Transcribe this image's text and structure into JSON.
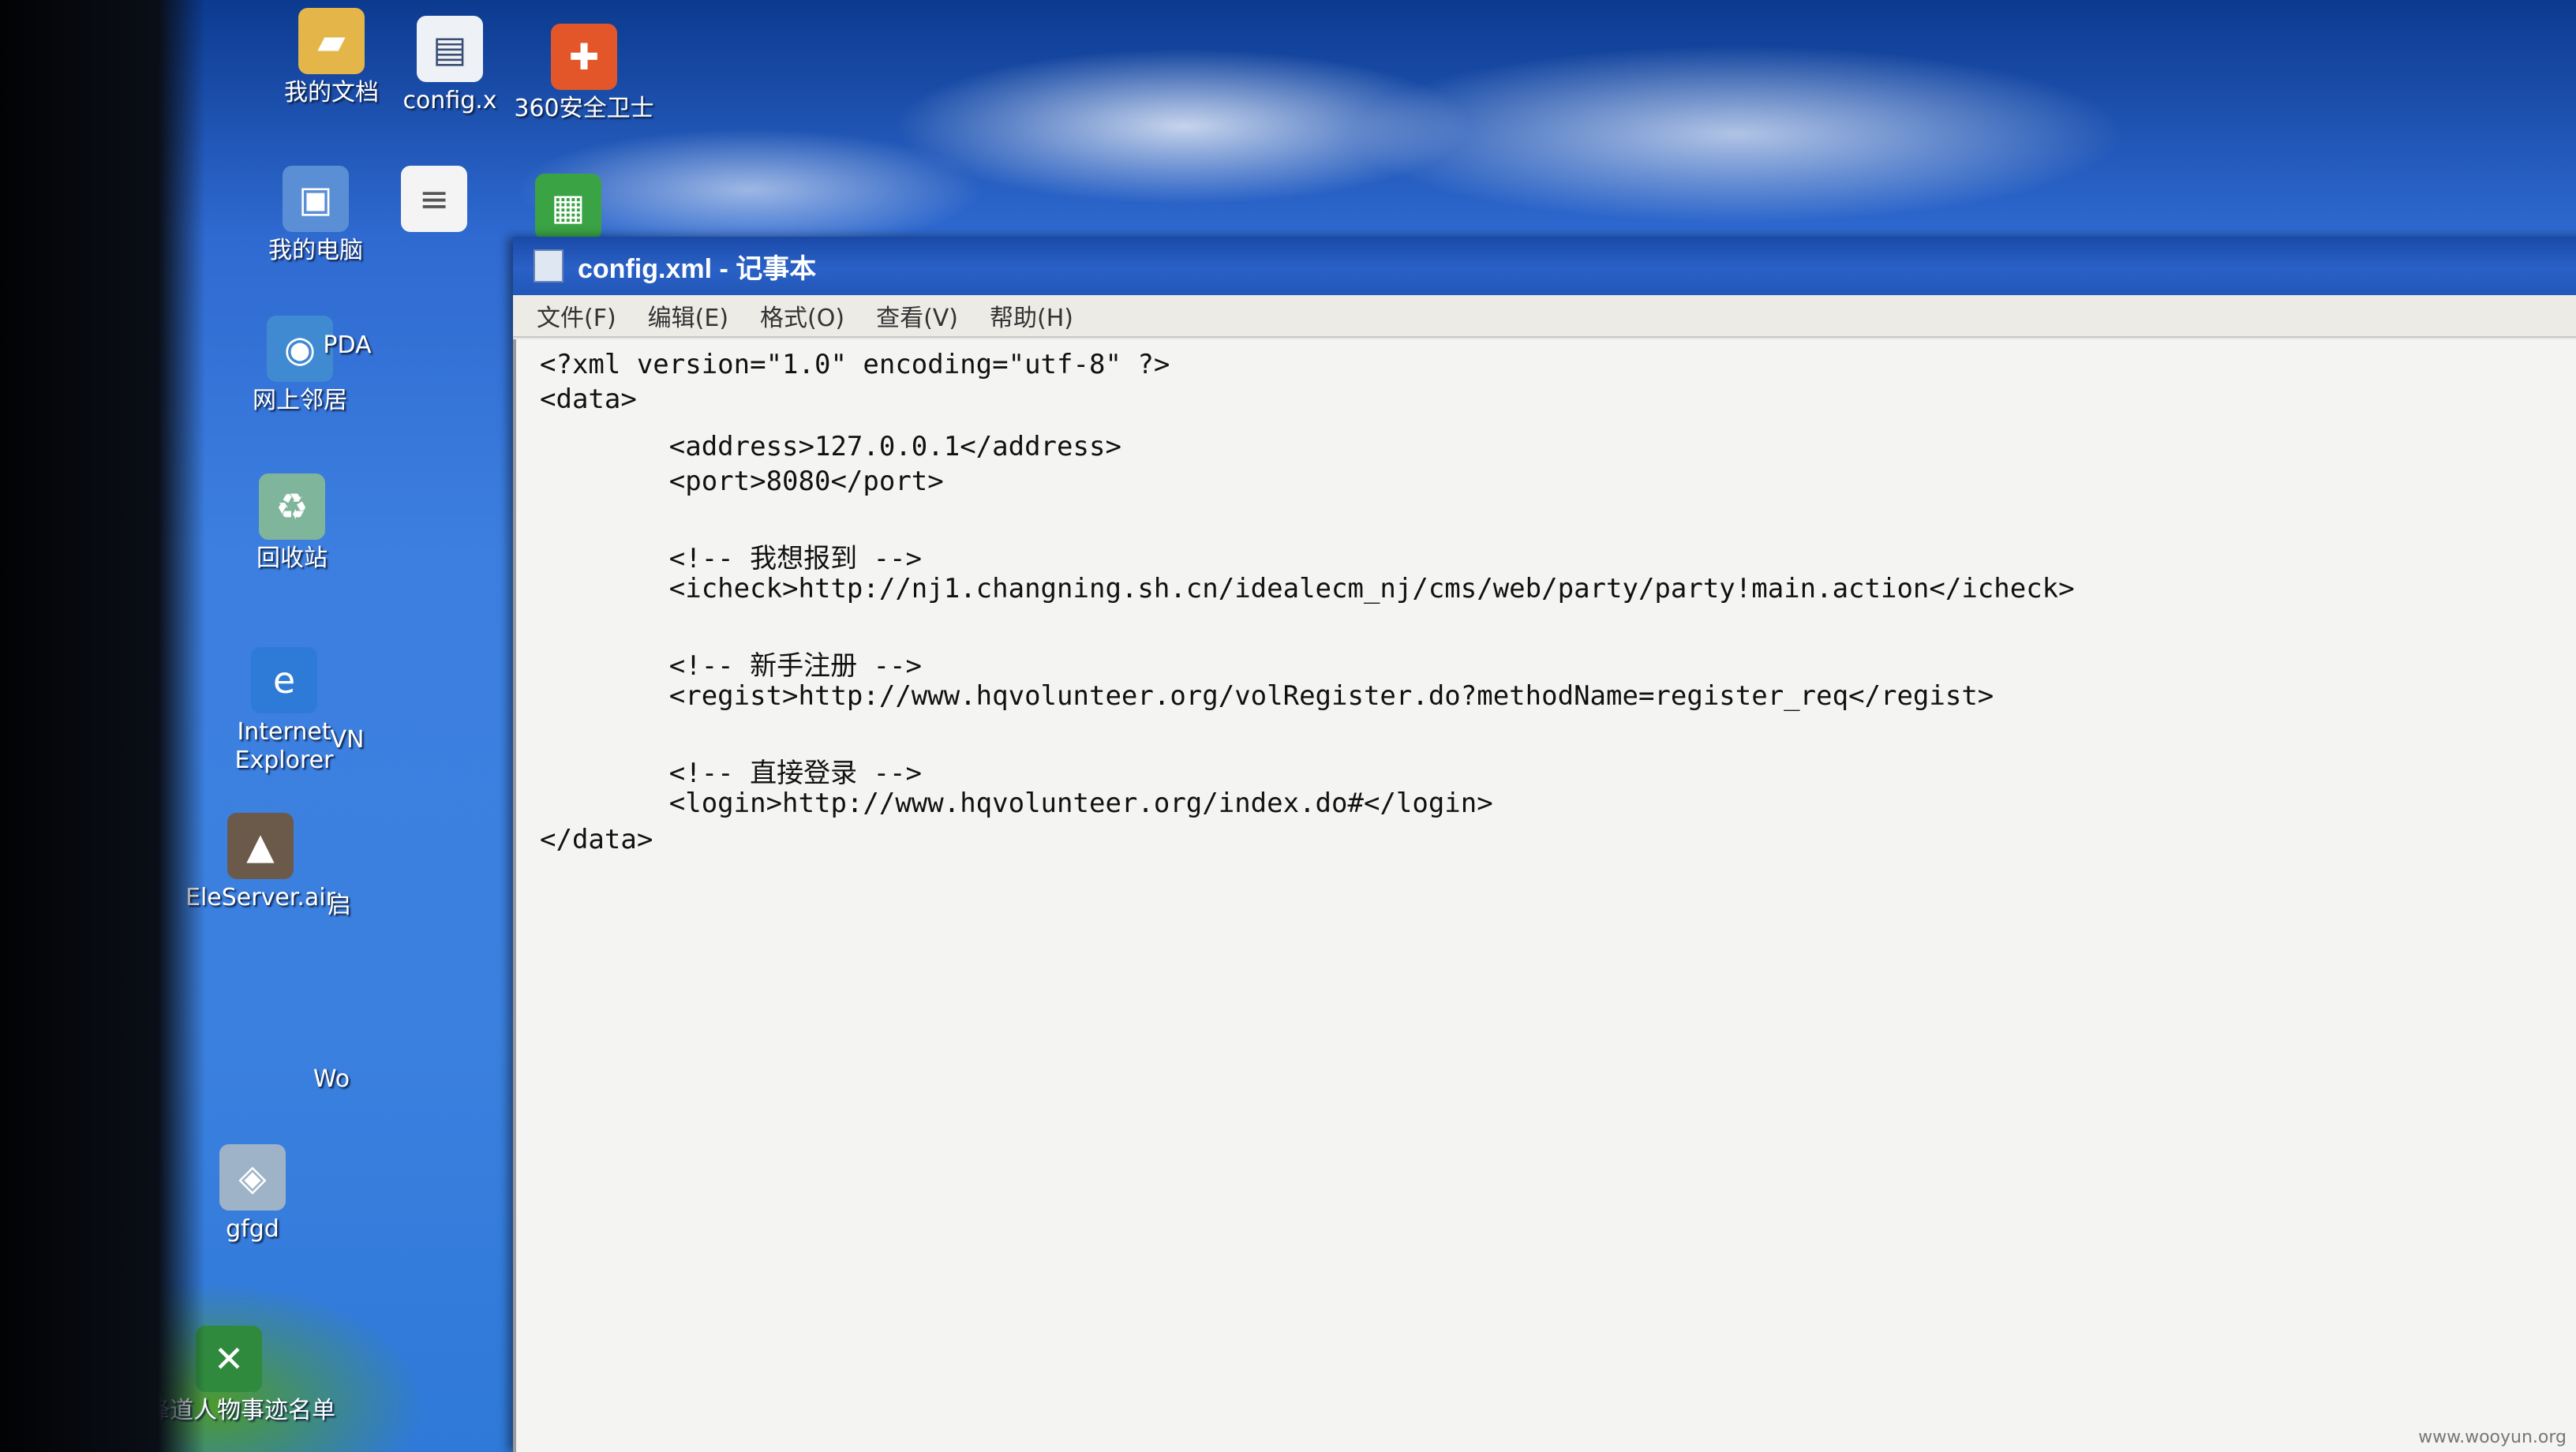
{
  "desktop": {
    "icons": [
      {
        "label": "我的文档",
        "icon": "my-documents-icon"
      },
      {
        "label": "config.x",
        "icon": "xml-file-icon"
      },
      {
        "label": "360安全卫士",
        "icon": "security-360-icon"
      },
      {
        "label": "我的电脑",
        "icon": "my-computer-icon"
      },
      {
        "label": "",
        "icon": "text-document-icon"
      },
      {
        "label": "",
        "icon": "app-shortcut-icon"
      },
      {
        "label": "网上邻居",
        "icon": "network-places-icon"
      },
      {
        "label": "PDA",
        "icon": "pda-icon"
      },
      {
        "label": "回收站",
        "icon": "recycle-bin-icon"
      },
      {
        "label": "Internet Explorer",
        "icon": "internet-explorer-icon"
      },
      {
        "label": "VN",
        "icon": "vnc-icon"
      },
      {
        "label": "EleServer.air",
        "icon": "air-app-icon"
      },
      {
        "label": "启",
        "icon": "app-icon"
      },
      {
        "label": "Wo",
        "icon": "word-icon"
      },
      {
        "label": "gfgd",
        "icon": "network-shortcut-icon"
      },
      {
        "label": "先锋道人物事迹名单",
        "icon": "excel-file-icon"
      }
    ]
  },
  "notepad": {
    "title": "config.xml - 记事本",
    "menu": [
      "文件(F)",
      "编辑(E)",
      "格式(O)",
      "查看(V)",
      "帮助(H)"
    ],
    "lines": [
      "<?xml version=\"1.0\" encoding=\"utf-8\" ?>",
      "<data>",
      "        <address>127.0.0.1</address>",
      "        <port>8080</port>",
      "",
      "        <!-- 我想报到 -->",
      "        <icheck>http://nj1.changning.sh.cn/idealecm_nj/cms/web/party/party!main.action</icheck>",
      "",
      "        <!-- 新手注册 -->",
      "        <regist>http://www.hqvolunteer.org/volRegister.do?methodName=register_req</regist>",
      "",
      "        <!-- 直接登录 -->",
      "        <login>http://www.hqvolunteer.org/index.do#</login>",
      "</data>"
    ]
  },
  "watermark": "www.wooyun.org"
}
